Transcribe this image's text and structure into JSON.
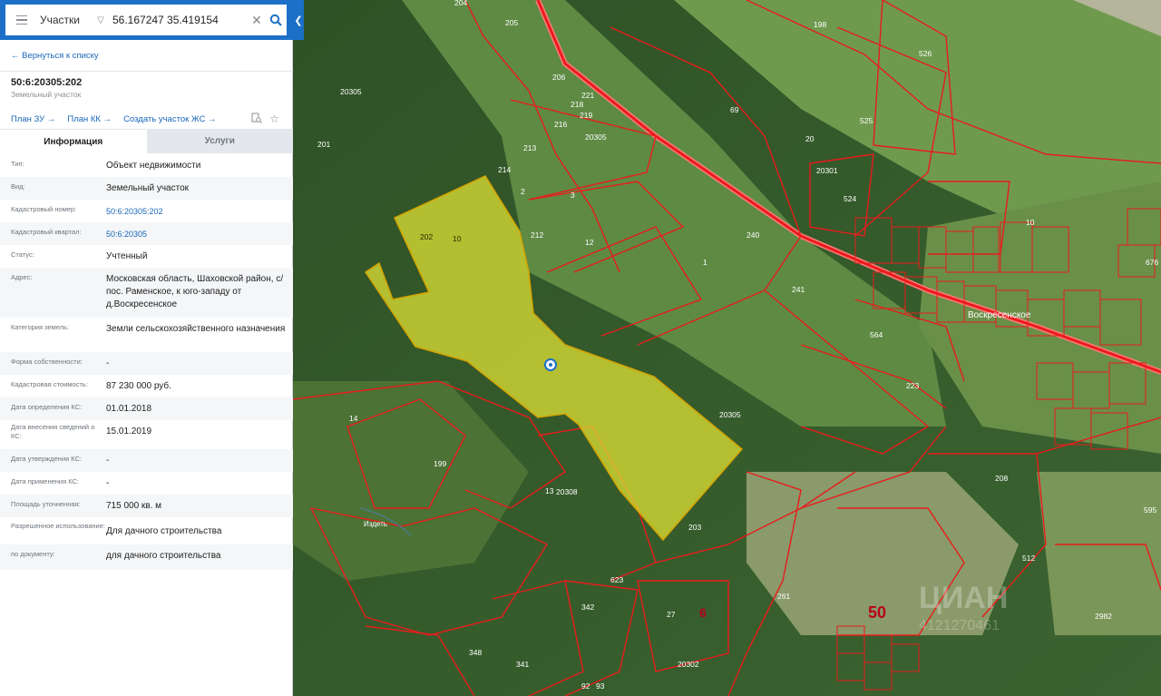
{
  "search": {
    "type_label": "Участки",
    "query": "56.167247 35.419154"
  },
  "panel": {
    "back_label": "← Вернуться к списку",
    "cadastral_number": "50:6:20305:202",
    "object_kind": "Земельный участок",
    "links": [
      "План ЗУ →",
      "План КК →",
      "Создать участок ЖС →"
    ],
    "tabs": [
      "Информация",
      "Услуги"
    ],
    "rows": [
      {
        "key": "Тип:",
        "value": "Объект недвижимости",
        "link": false
      },
      {
        "key": "Вид:",
        "value": "Земельный участок",
        "link": false
      },
      {
        "key": "Кадастровый номер:",
        "value": "50:6:20305:202",
        "link": true
      },
      {
        "key": "Кадастровый квартал:",
        "value": "50:6:20305",
        "link": true
      },
      {
        "key": "Статус:",
        "value": "Учтенный",
        "link": false
      },
      {
        "key": "Адрес:",
        "value": "Московская область, Шаховской район, с/пос. Раменское, к юго-западу от д.Воскресенское",
        "link": false
      },
      {
        "key": "Категория земель:",
        "value": "Земли сельскохозяйственного назначения",
        "link": false
      },
      {
        "key": "Форма собственности:",
        "value": "-",
        "link": false
      },
      {
        "key": "Кадастровая стоимость:",
        "value": "87 230 000 руб.",
        "link": false
      },
      {
        "key": "Дата определения КС:",
        "value": "01.01.2018",
        "link": false
      },
      {
        "key": "Дата внесения сведений о КС:",
        "value": "15.01.2019",
        "link": false
      },
      {
        "key": "Дата утверждения КС:",
        "value": "-",
        "link": false
      },
      {
        "key": "Дата применения КС:",
        "value": "-",
        "link": false
      },
      {
        "key": "Площадь уточненная:",
        "value": "715 000 кв. м",
        "link": false
      },
      {
        "key": "Разрешенное использование:",
        "value": "Для дачного строительства",
        "link": false
      },
      {
        "key": "по документу:",
        "value": "для дачного строительства",
        "link": false
      }
    ]
  },
  "map": {
    "village_label": "Воскресенское",
    "river_label": "Издеть",
    "district_number": "50",
    "sub_district_number": "6",
    "watermark": "ЦИАН",
    "watermark_id": "4121270461",
    "parcel_labels": [
      "204",
      "205",
      "206",
      "198",
      "526",
      "20305",
      "201",
      "69",
      "20",
      "20301",
      "525",
      "524",
      "240",
      "241",
      "564",
      "10",
      "2",
      "3",
      "12",
      "1",
      "202",
      "10",
      "20305",
      "203",
      "199",
      "13",
      "14",
      "208",
      "595",
      "512",
      "2982",
      "348",
      "341",
      "92",
      "93",
      "27",
      "261",
      "20302",
      "342",
      "623",
      "223",
      "676",
      "213",
      "218",
      "221",
      "219",
      "216",
      "214",
      "212",
      "20308"
    ]
  },
  "colors": {
    "accent": "#1c70c7",
    "link": "#1a66b8",
    "parcel_fill": "#e6e635",
    "parcel_border": "#e81c1c"
  }
}
